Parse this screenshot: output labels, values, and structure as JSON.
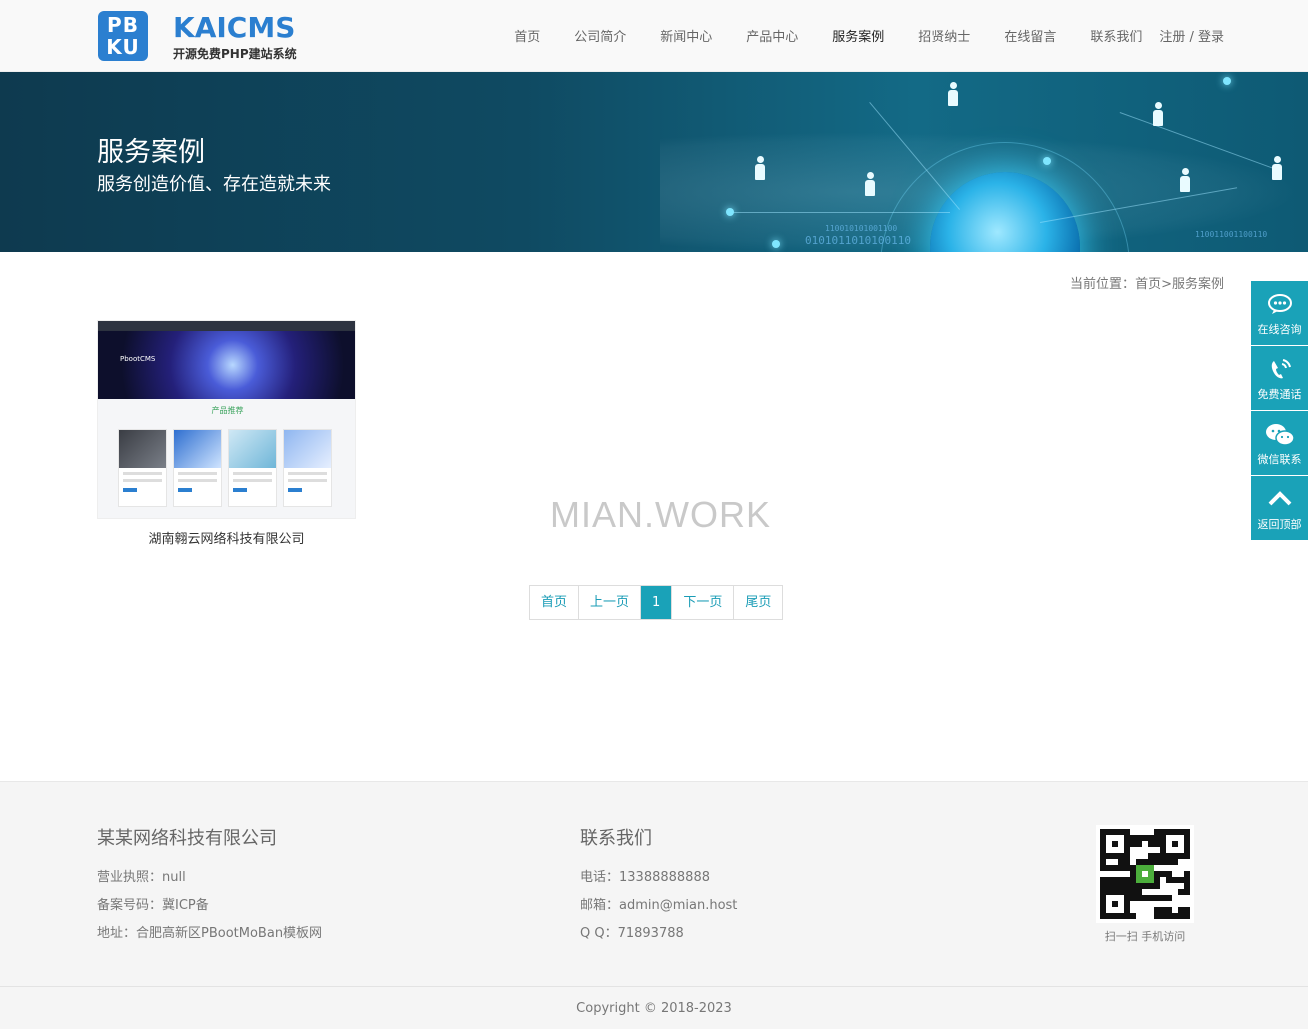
{
  "header": {
    "logo": {
      "badge_top": "PB",
      "badge_bottom": "KU",
      "title": "KAICMS",
      "subtitle": "开源免费PHP建站系统"
    },
    "nav": [
      {
        "label": "首页",
        "active": false
      },
      {
        "label": "公司简介",
        "active": false
      },
      {
        "label": "新闻中心",
        "active": false
      },
      {
        "label": "产品中心",
        "active": false
      },
      {
        "label": "服务案例",
        "active": true
      },
      {
        "label": "招贤纳士",
        "active": false
      },
      {
        "label": "在线留言",
        "active": false
      },
      {
        "label": "联系我们",
        "active": false
      }
    ],
    "login_label": "注册 / 登录"
  },
  "banner": {
    "title": "服务案例",
    "subtitle": "服务创造价值、存在造就未来",
    "binary_1": "0101011010100110",
    "binary_2": "110010101001100",
    "binary_3": "110011001100110"
  },
  "breadcrumb": {
    "prefix": "当前位置：",
    "home": "首页",
    "separator": ">",
    "current": "服务案例"
  },
  "cases": [
    {
      "title": "湖南翱云网络科技有限公司",
      "thumb_brand": "PbootCMS",
      "thumb_section": "产品推荐"
    }
  ],
  "watermark": "MIAN.WORK",
  "pagination": {
    "first": "首页",
    "prev": "上一页",
    "current": "1",
    "next": "下一页",
    "last": "尾页"
  },
  "sidebar": [
    {
      "label": "在线咨询",
      "icon": "chat-icon"
    },
    {
      "label": "免费通话",
      "icon": "phone-icon"
    },
    {
      "label": "微信联系",
      "icon": "wechat-icon"
    },
    {
      "label": "返回顶部",
      "icon": "arrow-up-icon"
    }
  ],
  "footer": {
    "company": {
      "name": "某某网络科技有限公司",
      "license": "营业执照：null",
      "icp": "备案号码：冀ICP备",
      "address": "地址：合肥高新区PBootMoBan模板网"
    },
    "contact": {
      "heading": "联系我们",
      "phone": "电话：13388888888",
      "email": "邮箱：admin@mian.host",
      "qq": "Q  Q：71893788"
    },
    "qr_caption": "扫一扫 手机访问",
    "copyright": "Copyright © 2018-2023"
  },
  "colors": {
    "accent": "#1aa2b8",
    "logo_blue": "#2b7fd0",
    "banner_dark": "#0e3a4f"
  }
}
